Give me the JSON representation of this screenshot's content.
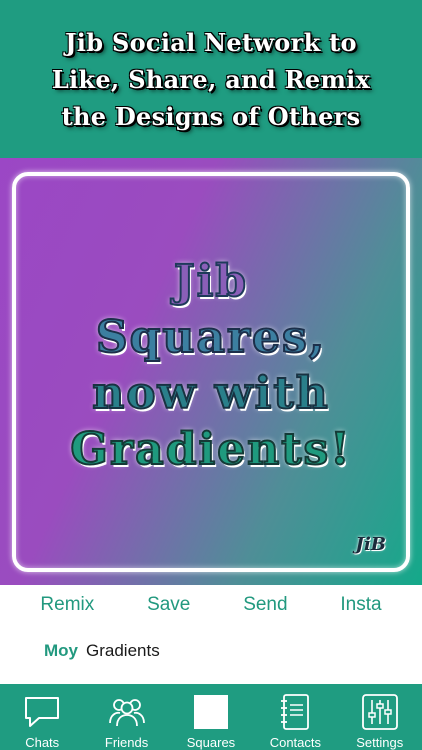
{
  "header": {
    "title_line1": "Jib Social Network to",
    "title_line2": "Like, Share, and Remix",
    "title_line3": "the Designs of Others"
  },
  "square": {
    "line1": "Jib",
    "line2": "Squares,",
    "line3": "now with",
    "line4": "Gradients!",
    "logo": "JiB"
  },
  "actions": {
    "remix": "Remix",
    "save": "Save",
    "send": "Send",
    "insta": "Insta"
  },
  "caption": {
    "user": "Moy",
    "text": "Gradients"
  },
  "tabs": [
    {
      "label": "Chats",
      "icon": "chat-bubble-icon"
    },
    {
      "label": "Friends",
      "icon": "friends-icon"
    },
    {
      "label": "Squares",
      "icon": "square-icon"
    },
    {
      "label": "Contacts",
      "icon": "contacts-book-icon"
    },
    {
      "label": "Settings",
      "icon": "sliders-icon"
    }
  ],
  "colors": {
    "brand": "#1f9c81",
    "gradient_start": "#9b47c5",
    "gradient_end": "#14a98a"
  }
}
